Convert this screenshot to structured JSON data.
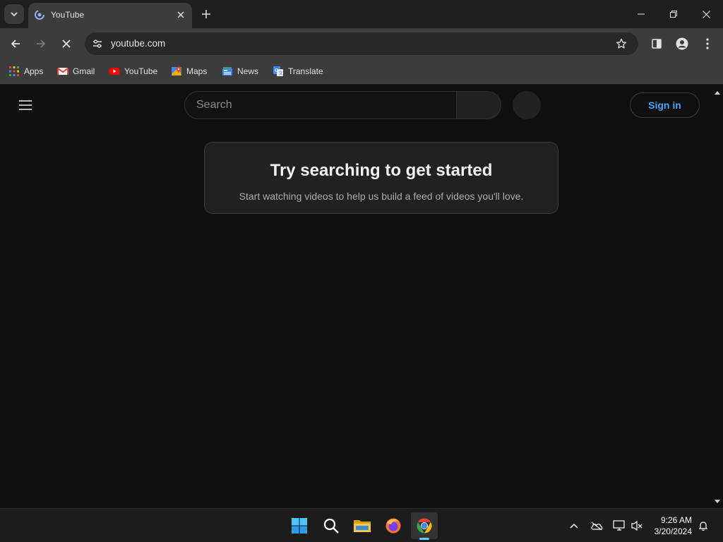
{
  "browser": {
    "tab": {
      "title": "YouTube"
    },
    "url": "youtube.com"
  },
  "bookmarks": [
    {
      "label": "Apps",
      "icon": "apps-grid-icon"
    },
    {
      "label": "Gmail",
      "icon": "gmail-icon"
    },
    {
      "label": "YouTube",
      "icon": "youtube-icon"
    },
    {
      "label": "Maps",
      "icon": "maps-icon"
    },
    {
      "label": "News",
      "icon": "news-icon"
    },
    {
      "label": "Translate",
      "icon": "translate-icon"
    }
  ],
  "youtube": {
    "search_placeholder": "Search",
    "signin_label": "Sign in",
    "card_title": "Try searching to get started",
    "card_subtitle": "Start watching videos to help us build a feed of videos you'll love."
  },
  "taskbar": {
    "apps": [
      "start-icon",
      "search-icon",
      "file-explorer-icon",
      "firefox-icon",
      "chrome-icon"
    ],
    "time": "9:26 AM",
    "date": "3/20/2024"
  },
  "colors": {
    "accent_blue": "#3ea6ff",
    "page_bg": "#0f0f0f",
    "toolbar_bg": "#3c3c3c"
  }
}
